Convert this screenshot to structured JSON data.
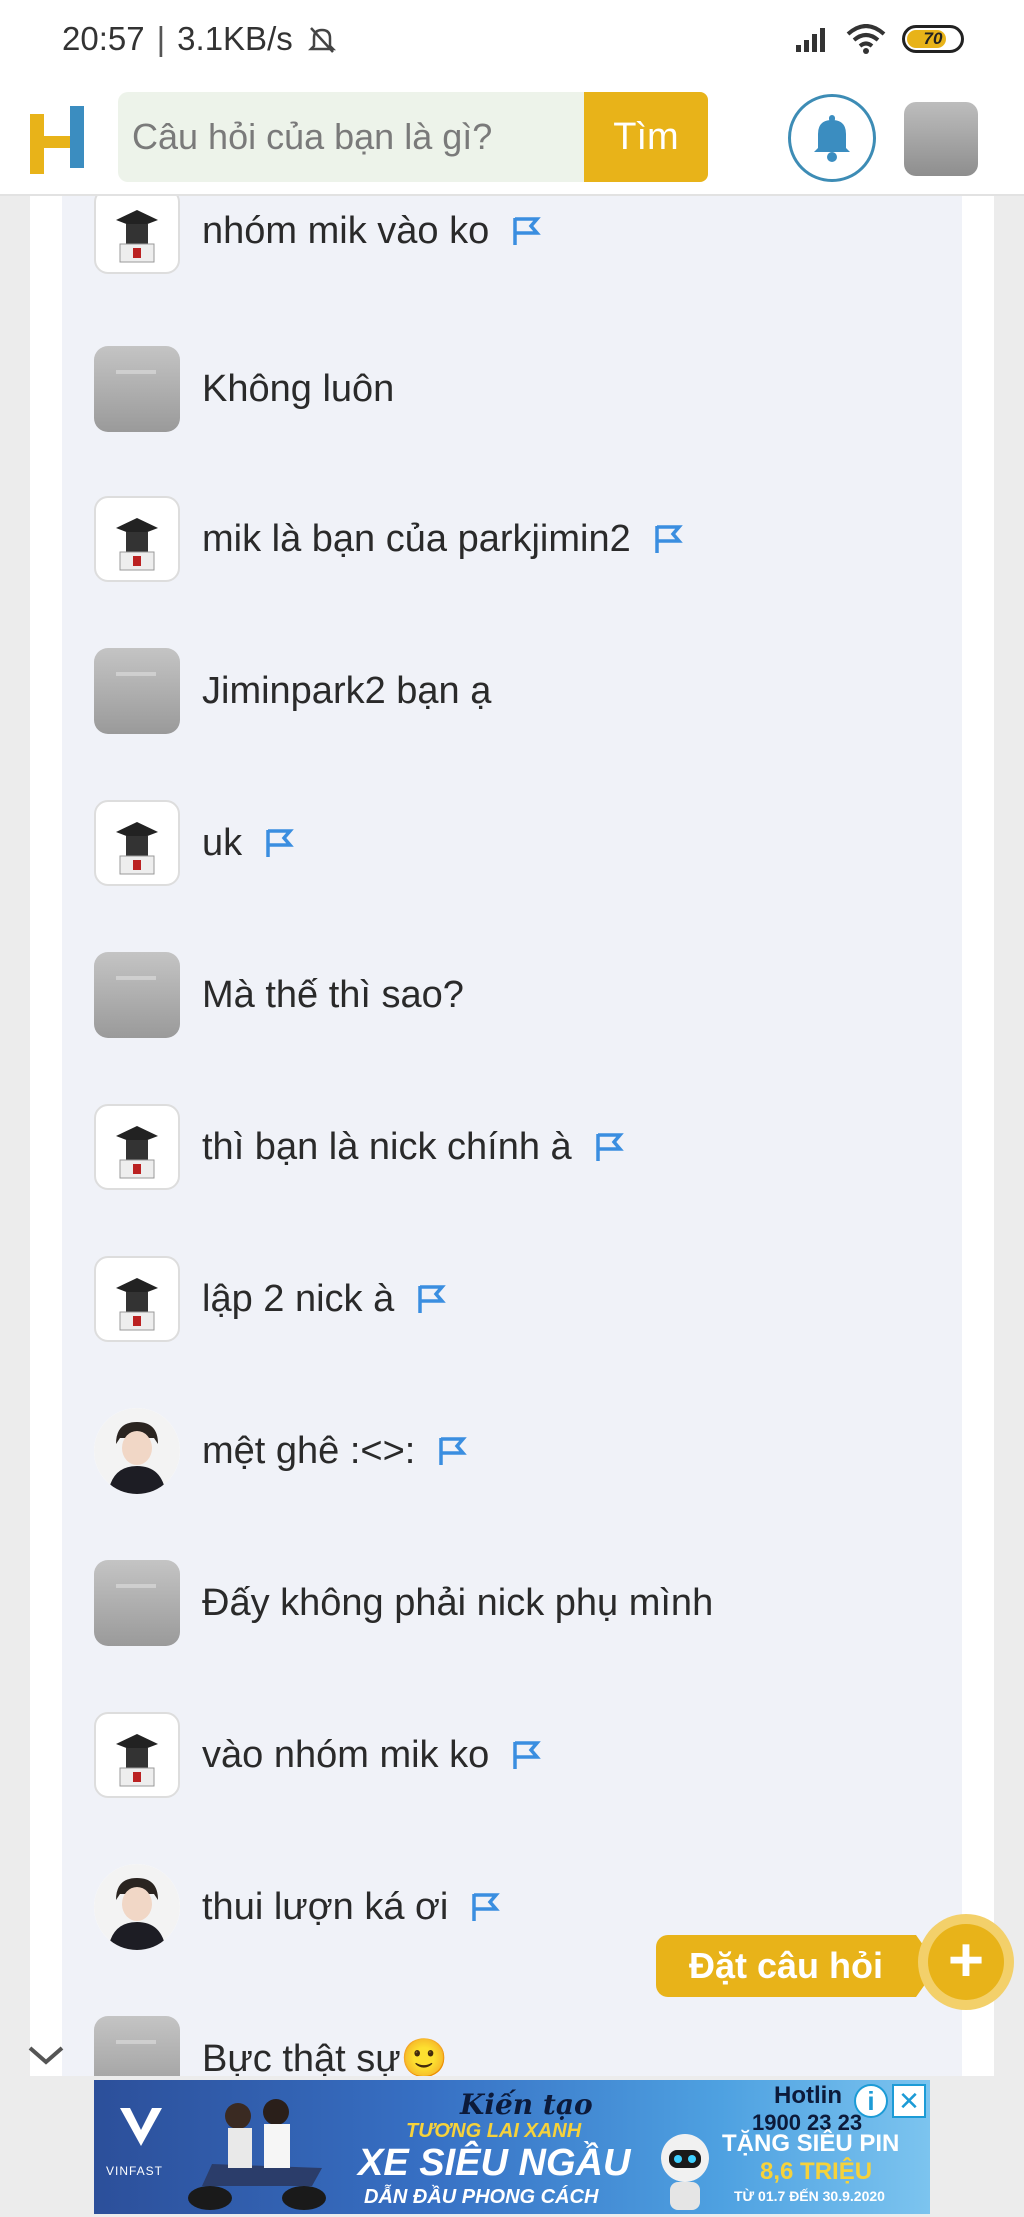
{
  "status": {
    "time": "20:57",
    "speed": "3.1KB/s",
    "battery": "70",
    "battery_level": 0.7
  },
  "header": {
    "search_placeholder": "Câu hỏi của bạn là gì?",
    "search_button": "Tìm"
  },
  "comments": [
    {
      "avatar": "drawn",
      "text": "nhóm mik vào ko",
      "flag": true
    },
    {
      "avatar": "gray",
      "text": "Không luôn",
      "flag": false
    },
    {
      "avatar": "drawn",
      "text": "mik là bạn của parkjimin2",
      "flag": true
    },
    {
      "avatar": "gray",
      "text": "Jiminpark2 bạn ạ",
      "flag": false
    },
    {
      "avatar": "drawn",
      "text": "uk",
      "flag": true
    },
    {
      "avatar": "gray",
      "text": "Mà thế thì sao?",
      "flag": false
    },
    {
      "avatar": "drawn",
      "text": "thì bạn là nick chính à",
      "flag": true
    },
    {
      "avatar": "drawn",
      "text": "lập 2 nick à",
      "flag": true
    },
    {
      "avatar": "photo",
      "text": "mệt ghê :<>:",
      "flag": true
    },
    {
      "avatar": "gray",
      "text": "Đấy không phải nick phụ mình",
      "flag": false
    },
    {
      "avatar": "drawn",
      "text": "vào nhóm mik ko",
      "flag": true
    },
    {
      "avatar": "photo",
      "text": "thui lượn ká ơi",
      "flag": true
    },
    {
      "avatar": "gray",
      "text": "Bực thật sự🙂",
      "flag": false
    }
  ],
  "ask_button": "Đặt câu hỏi",
  "ad": {
    "script_text": "Kiến tạo",
    "subtitle": "TƯƠNG LAI XANH",
    "headline": "XE SIÊU NGẦU",
    "tagline": "DẪN ĐẦU PHONG CÁCH",
    "hotline_label": "Hotlin",
    "hotline_number": "1900 23 23",
    "promo_line1": "TẶNG SIÊU PIN",
    "promo_line2": "8,6 TRIỆU",
    "date_range": "TỪ 01.7 ĐẾN 30.9.2020",
    "brand": "VINFAST"
  }
}
